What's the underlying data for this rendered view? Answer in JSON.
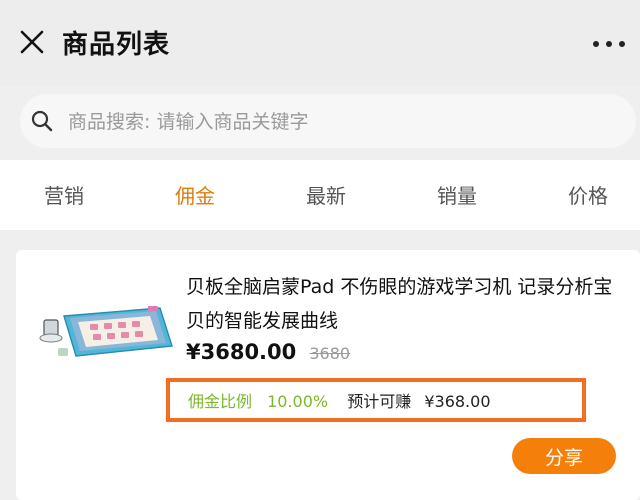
{
  "header": {
    "title": "商品列表",
    "close_icon": "close-icon",
    "more_icon": "more-icon"
  },
  "search": {
    "placeholder": "商品搜索: 请输入商品关键字",
    "value": "",
    "icon": "search-icon"
  },
  "tabs": [
    {
      "label": "营销",
      "active": false
    },
    {
      "label": "佣金",
      "active": true
    },
    {
      "label": "最新",
      "active": false
    },
    {
      "label": "销量",
      "active": false
    },
    {
      "label": "价格",
      "active": false
    }
  ],
  "colors": {
    "accent": "#e07b0b",
    "share_button": "#f57f0b",
    "highlight_border": "#f26f21",
    "commission_green": "#7bb82a"
  },
  "product": {
    "title": "贝板全脑启蒙Pad 不伤眼的游戏学习机 记录分析宝贝的智能发展曲线",
    "price": "¥3680.00",
    "original_price": "3680",
    "commission_label": "佣金比例",
    "commission_rate": "10.00%",
    "earn_label": "预计可赚",
    "earn_value": "¥368.00",
    "share_label": "分享"
  }
}
